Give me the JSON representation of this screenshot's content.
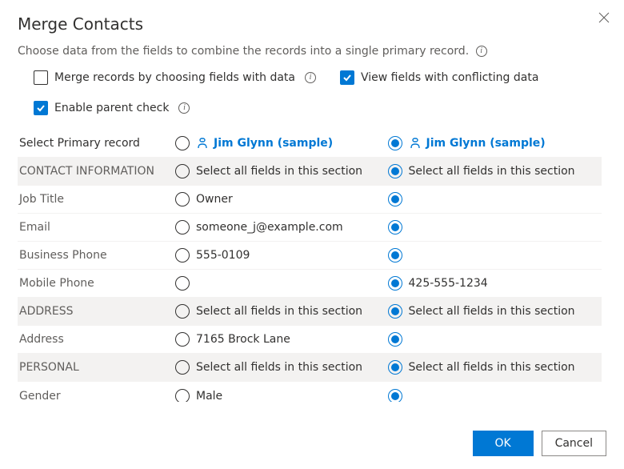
{
  "dialog": {
    "title": "Merge Contacts",
    "subtitle": "Choose data from the fields to combine the records into a single primary record."
  },
  "options": {
    "merge_by_fields": {
      "label": "Merge records by choosing fields with data",
      "checked": false
    },
    "view_conflicting": {
      "label": "View fields with conflicting data",
      "checked": true
    },
    "enable_parent": {
      "label": "Enable parent check",
      "checked": true
    }
  },
  "primary_row_label": "Select Primary record",
  "records": {
    "left": {
      "name": "Jim Glynn (sample)"
    },
    "right": {
      "name": "Jim Glynn (sample)"
    }
  },
  "section_select_all_label": "Select all fields in this section",
  "sections": [
    {
      "title": "CONTACT INFORMATION",
      "fields": [
        {
          "label": "Job Title",
          "left": "Owner",
          "right": ""
        },
        {
          "label": "Email",
          "left": "someone_j@example.com",
          "right": ""
        },
        {
          "label": "Business Phone",
          "left": "555-0109",
          "right": ""
        },
        {
          "label": "Mobile Phone",
          "left": "",
          "right": "425-555-1234"
        }
      ]
    },
    {
      "title": "ADDRESS",
      "fields": [
        {
          "label": "Address",
          "left": "7165 Brock Lane",
          "right": ""
        }
      ]
    },
    {
      "title": "PERSONAL",
      "fields": [
        {
          "label": "Gender",
          "left": "Male",
          "right": ""
        }
      ]
    }
  ],
  "footer": {
    "ok": "OK",
    "cancel": "Cancel"
  }
}
